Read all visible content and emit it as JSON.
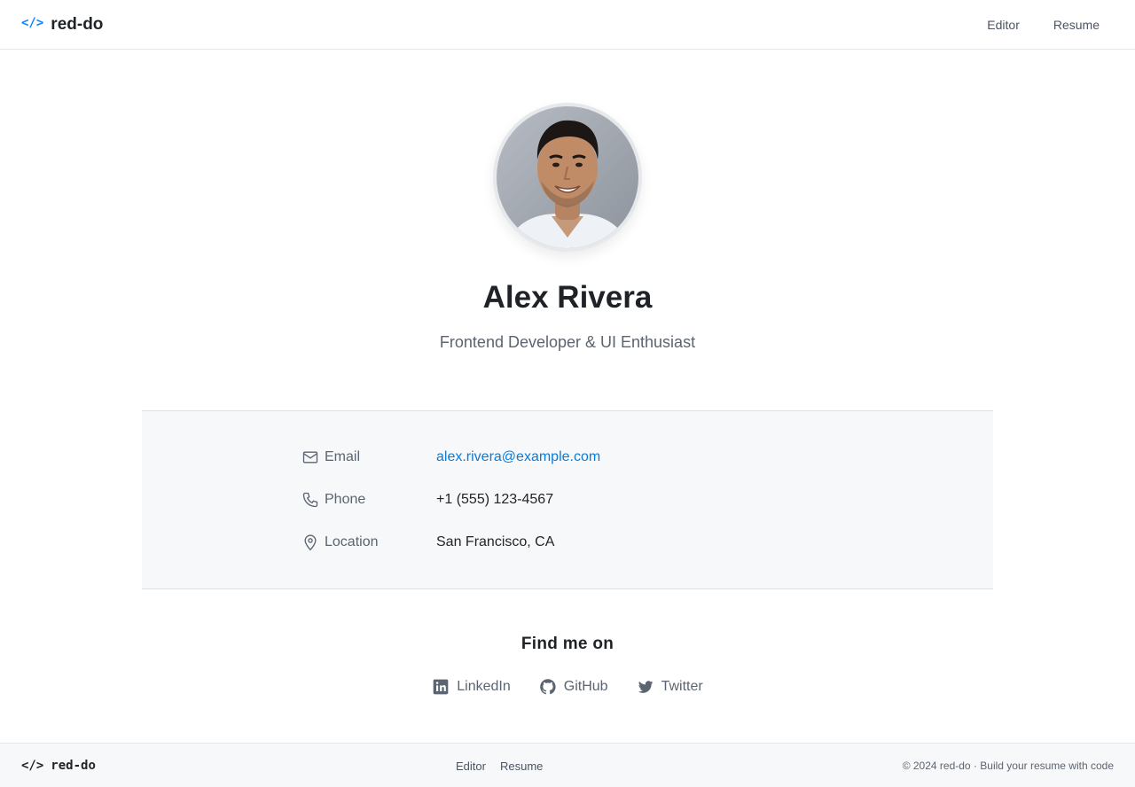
{
  "header": {
    "brand_mark": "</>",
    "brand_name": "red-do",
    "nav": [
      "Editor",
      "Resume"
    ]
  },
  "profile": {
    "name": "Alex Rivera",
    "tagline": "Frontend Developer & UI Enthusiast"
  },
  "contact": {
    "email_label": "Email",
    "email_value": "alex.rivera@example.com",
    "phone_label": "Phone",
    "phone_value": "+1 (555) 123-4567",
    "location_label": "Location",
    "location_value": "San Francisco, CA"
  },
  "social": {
    "heading": "Find me on",
    "links": [
      "LinkedIn",
      "GitHub",
      "Twitter"
    ]
  },
  "footer": {
    "brand_mark": "</>",
    "brand_name": "red-do",
    "nav": [
      "Editor",
      "Resume"
    ],
    "copyright": "© 2024 red-do · Build your resume with code"
  },
  "colors": {
    "accent": "#0a84ff",
    "link": "#0a7bd8",
    "text": "#1f2328",
    "muted": "#5b6470",
    "panel_bg": "#f7f8fa"
  },
  "icons": {
    "email": "mail-icon",
    "phone": "phone-icon",
    "location": "map-pin-icon",
    "linkedin": "linkedin-icon",
    "github": "github-icon",
    "twitter": "twitter-icon"
  }
}
